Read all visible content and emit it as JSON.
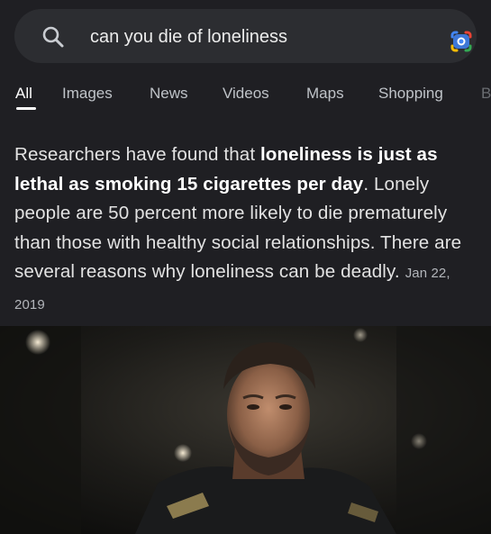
{
  "search": {
    "query": "can you die of loneliness",
    "icon": "search-icon",
    "lens_icon": "google-lens-icon"
  },
  "tabs": [
    {
      "label": "All",
      "active": true
    },
    {
      "label": "Images"
    },
    {
      "label": "News"
    },
    {
      "label": "Videos"
    },
    {
      "label": "Maps"
    },
    {
      "label": "Shopping"
    },
    {
      "label": "B"
    }
  ],
  "snippet": {
    "part1": "Researchers have found that ",
    "bold": "loneliness is just as lethal as smoking 15 cigarettes per day",
    "part2": ". Lonely people are 50 percent more likely to die prematurely than those with healthy social relationships. There are several reasons why loneliness can be deadly.",
    "date": "Jan 22, 2019"
  },
  "colors": {
    "panel_bg": "#1f1f23",
    "search_bg": "#2c2d31",
    "tab_inactive": "#bfc3c8",
    "text": "#e2e2e2"
  }
}
